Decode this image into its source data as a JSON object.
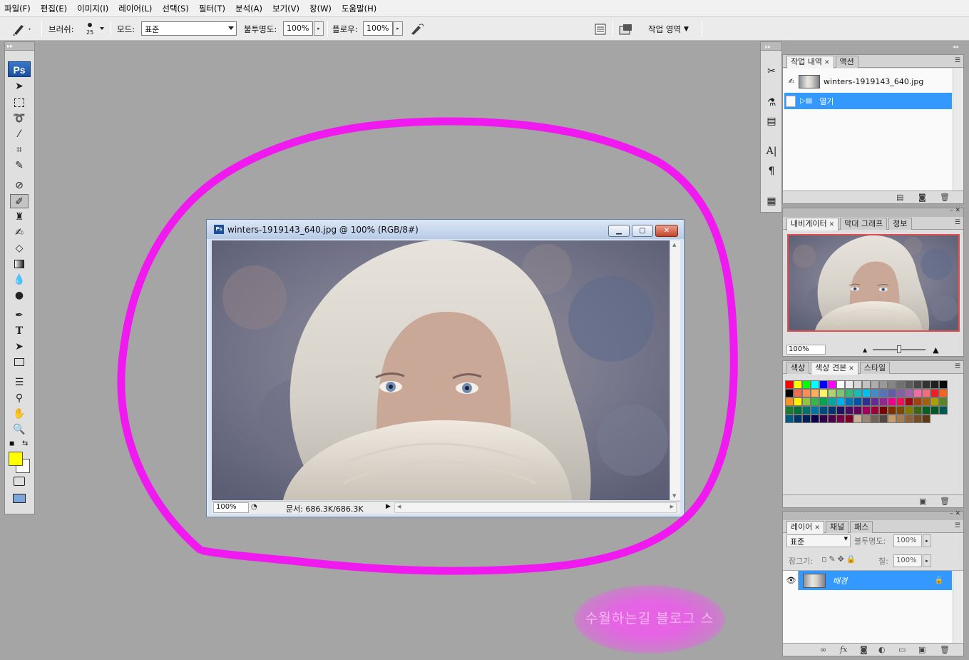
{
  "menubar": {
    "items": [
      "파일(F)",
      "편집(E)",
      "이미지(I)",
      "레이어(L)",
      "선택(S)",
      "필터(T)",
      "분석(A)",
      "보기(V)",
      "창(W)",
      "도움말(H)"
    ]
  },
  "options": {
    "brush_label": "브러쉬:",
    "brush_size": "25",
    "mode_label": "모드:",
    "mode_value": "표준",
    "opacity_label": "불투명도:",
    "opacity_value": "100%",
    "flow_label": "플로우:",
    "flow_value": "100%",
    "workspace_label": "작업 영역"
  },
  "tools": {
    "logo": "Ps",
    "type_tool_glyph": "T",
    "foreground_color": "#ffff00",
    "background_color": "#ffffff"
  },
  "history_panel": {
    "tabs": [
      "작업 내역",
      "액션"
    ],
    "snapshot_name": "winters-1919143_640.jpg",
    "step_name": "열기"
  },
  "navigator_panel": {
    "tabs": [
      "내비게이터",
      "막대 그래프",
      "정보"
    ],
    "zoom": "100%"
  },
  "swatch_panel": {
    "tabs": [
      "색상",
      "색상 견본",
      "스타일"
    ]
  },
  "layers_panel": {
    "tabs": [
      "레이어",
      "채널",
      "패스"
    ],
    "blend_mode": "표준",
    "opacity_label": "불투명도:",
    "opacity_value": "100%",
    "lock_label": "잠그기:",
    "fill_label": "칠:",
    "fill_value": "100%",
    "layer_name": "배경"
  },
  "document": {
    "title": "winters-1919143_640.jpg @ 100% (RGB/8#)",
    "zoom": "100%",
    "doc_size": "문서: 686.3K/686.3K"
  },
  "overlay": {
    "watermark_text": "수월하는길 블로그 스",
    "annotation_color": "#f01af0"
  },
  "colors": {
    "selection_blue": "#3399ff",
    "workspace_gray": "#a5a5a5"
  }
}
